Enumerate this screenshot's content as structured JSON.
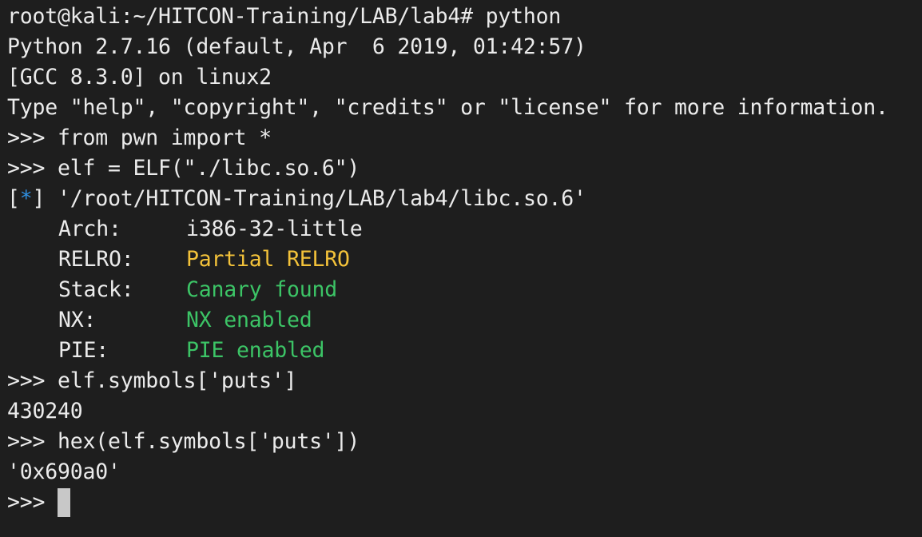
{
  "terminal": {
    "lines": {
      "l0": "root@kali:~/HITCON-Training/LAB/lab4# python",
      "l1": "Python 2.7.16 (default, Apr  6 2019, 01:42:57)",
      "l2": "[GCC 8.3.0] on linux2",
      "l3": "Type \"help\", \"copyright\", \"credits\" or \"license\" for more information.",
      "l4": ">>> from pwn import *",
      "l5": ">>> elf = ELF(\"./libc.so.6\")",
      "l11": ">>> elf.symbols['puts']",
      "l12": "430240",
      "l13": ">>> hex(elf.symbols['puts'])",
      "l14": "'0x690a0'",
      "l15": ">>> "
    },
    "load_line": {
      "open_bracket": "[",
      "star": "*",
      "close_bracket": "]",
      "path": " '/root/HITCON-Training/LAB/lab4/libc.so.6'"
    },
    "checksec": [
      {
        "key": "Arch:",
        "value": "i386-32-little"
      },
      {
        "key": "RELRO:",
        "value": "Partial RELRO"
      },
      {
        "key": "Stack:",
        "value": "Canary found"
      },
      {
        "key": "NX:",
        "value": "NX enabled"
      },
      {
        "key": "PIE:",
        "value": "PIE enabled"
      }
    ],
    "colors": {
      "background": "#1e1e1e",
      "foreground": "#ebebeb",
      "info_star": "#2f8fe0",
      "warning": "#f3c23a",
      "ok": "#3cc466"
    }
  }
}
